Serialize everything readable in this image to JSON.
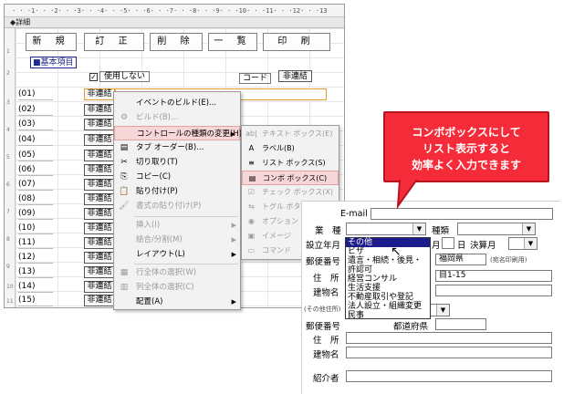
{
  "designer": {
    "ruler_text": "· · ·1· · ·2· · ·3· · ·4· · ·5· · ·6· · ·7· · ·8· · ·9· · ·10· · ·11· · ·12· · ·13",
    "section_label": "◆詳細",
    "top_buttons": [
      "新 規",
      "訂 正",
      "削 除",
      "一 覧",
      "印 刷"
    ],
    "group_label": "■基本項目",
    "checkbox_label": "使用しない",
    "code_label": "コード",
    "code_button": "非連結",
    "rows": [
      "(01)",
      "(02)",
      "(03)",
      "(04)",
      "(05)",
      "(06)",
      "(07)",
      "(08)",
      "(09)",
      "(10)",
      "(11)",
      "(12)",
      "(13)",
      "(14)",
      "(15)"
    ],
    "row_button": "非連結",
    "vruler_ticks": [
      "1",
      "2",
      "3",
      "4",
      "5",
      "6",
      "7",
      "8",
      "9",
      "10",
      "11"
    ]
  },
  "context_menu": {
    "items": [
      {
        "icon": "",
        "label": "イベントのビルド(E)...",
        "disabled": false,
        "submenu": false
      },
      {
        "icon": "⚙",
        "label": "ビルド(B)...",
        "disabled": true,
        "submenu": false
      },
      {
        "icon": "",
        "label": "コントロールの種類の変更(H)",
        "disabled": false,
        "submenu": true,
        "highlighted": true
      },
      {
        "icon": "▤",
        "label": "タブ オーダー(B)...",
        "disabled": false,
        "submenu": false
      },
      {
        "icon": "✂",
        "label": "切り取り(T)",
        "disabled": false,
        "submenu": false
      },
      {
        "icon": "⎘",
        "label": "コピー(C)",
        "disabled": false,
        "submenu": false
      },
      {
        "icon": "📋",
        "label": "貼り付け(P)",
        "disabled": false,
        "submenu": false
      },
      {
        "icon": "🖌",
        "label": "書式の貼り付け(P)",
        "disabled": true,
        "submenu": false
      },
      {
        "icon": "",
        "label": "挿入(I)",
        "disabled": true,
        "submenu": true
      },
      {
        "icon": "",
        "label": "結合/分割(M)",
        "disabled": true,
        "submenu": true
      },
      {
        "icon": "",
        "label": "レイアウト(L)",
        "disabled": false,
        "submenu": true
      },
      {
        "icon": "▦",
        "label": "行全体の選択(W)",
        "disabled": true,
        "submenu": false
      },
      {
        "icon": "▥",
        "label": "列全体の選択(C)",
        "disabled": true,
        "submenu": false
      },
      {
        "icon": "",
        "label": "配置(A)",
        "disabled": false,
        "submenu": true
      }
    ]
  },
  "submenu": {
    "items": [
      {
        "icon": "ab|",
        "label": "テキスト ボックス(E)",
        "disabled": true
      },
      {
        "icon": "A",
        "label": "ラベル(B)",
        "disabled": false
      },
      {
        "icon": "≡",
        "label": "リスト ボックス(S)",
        "disabled": false
      },
      {
        "icon": "▤",
        "label": "コンボ ボックス(C)",
        "disabled": false,
        "highlighted": true
      },
      {
        "icon": "☑",
        "label": "チェック ボックス(X)",
        "disabled": true
      },
      {
        "icon": "⇆",
        "label": "トグル ボタン(T)",
        "disabled": true
      },
      {
        "icon": "◉",
        "label": "オプション",
        "disabled": true
      },
      {
        "icon": "▣",
        "label": "イメージ",
        "disabled": true
      },
      {
        "icon": "▭",
        "label": "コマンド",
        "disabled": true
      }
    ]
  },
  "callout": {
    "lines": [
      "コンボボックスにして",
      "リスト表示すると",
      "効率よく入力できます"
    ]
  },
  "form": {
    "email_label": "E-mail",
    "gyoshu_label": "業　種",
    "shubetsu_label": "種類",
    "setsuritsu_label": "設立年月",
    "year_suffix": "月",
    "day_label": "日",
    "kessan_label": "決算月",
    "yubin_label": "郵便番号",
    "pref_value": "福岡県",
    "print_note": "(宛名印刷用)",
    "jusho_label": "住　所",
    "address_value": "目1-15",
    "tatemono_label": "建物名",
    "other_note": "(その他住所)",
    "yubin2_label": "郵便番号",
    "todofuken_label": "都道府県",
    "jusho2_label": "住　所",
    "tatemono2_label": "建物名",
    "shokai_label": "紹介者"
  },
  "dropdown": {
    "options": [
      "その他",
      "ビザ",
      "遺言・相続・後見・",
      "許認可",
      "経営コンサル",
      "生活支援",
      "不動産取引や登記",
      "法人設立・組織変更",
      "民事"
    ],
    "selected_index": 0
  }
}
